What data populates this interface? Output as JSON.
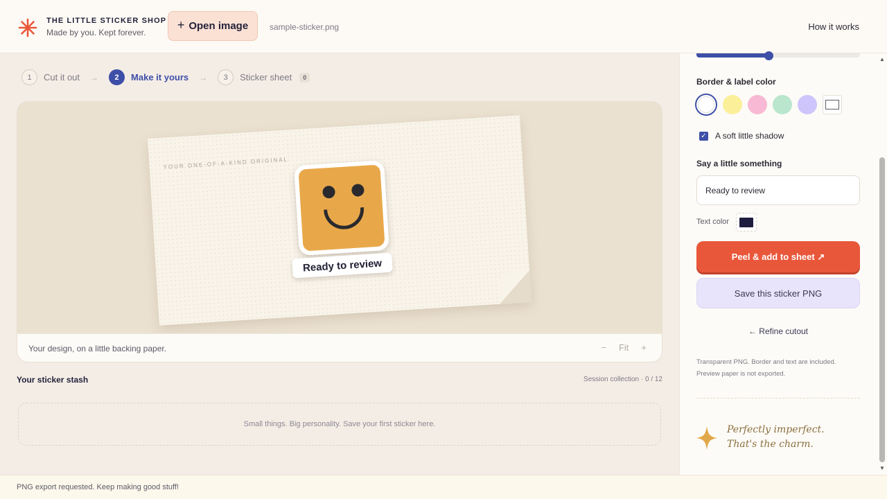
{
  "brand": {
    "name": "THE LITTLE STICKER SHOP",
    "tagline": "Made by you. Kept forever."
  },
  "header": {
    "open_label": "Open image",
    "file_name": "sample-sticker.png",
    "how_label": "How it works"
  },
  "steps": [
    {
      "num": "1",
      "label": "Cut it out"
    },
    {
      "num": "2",
      "label": "Make it yours",
      "active": true
    },
    {
      "num": "3",
      "label": "Sticker sheet",
      "badge": "0"
    }
  ],
  "canvas": {
    "paper_tag": "YOUR ONE-OF-A-KIND ORIGINAL",
    "sticker_label": "Ready to review",
    "caption": "Your design, on a little backing paper.",
    "zoom_out": "−",
    "zoom_fit": "Fit",
    "zoom_in": "+"
  },
  "stash": {
    "title": "Your sticker stash",
    "meta": "Session collection · 0 / 12",
    "empty": "Small things. Big personality. Save your first sticker here."
  },
  "status": "PNG export requested. Keep making good stuff!",
  "sidebar": {
    "size_level_percent": 44,
    "border_title": "Border & label color",
    "swatch_colors": [
      "#ffffff",
      "#fbef9a",
      "#f8b9d4",
      "#b9e6cc",
      "#cdc5fb"
    ],
    "shadow_label": "A soft little shadow",
    "shadow_checked": true,
    "say_title": "Say a little something",
    "say_value": "Ready to review",
    "text_color_label": "Text color",
    "text_color": "#1f1d3d",
    "peel_label": "Peel & add to sheet ↗",
    "save_label": "Save this sticker PNG",
    "refine_label": "← Refine cutout",
    "note": "Transparent PNG. Border and text are included. Preview paper is not exported.",
    "quote_line1": "Perfectly imperfect.",
    "quote_line2": "That's the charm."
  },
  "colors": {
    "accent": "#3e4fa8",
    "primary_button": "#e9573a",
    "brand_orange": "#e9573a",
    "sticker_face": "#e8a84a",
    "sparkle": "#e0a84a"
  }
}
